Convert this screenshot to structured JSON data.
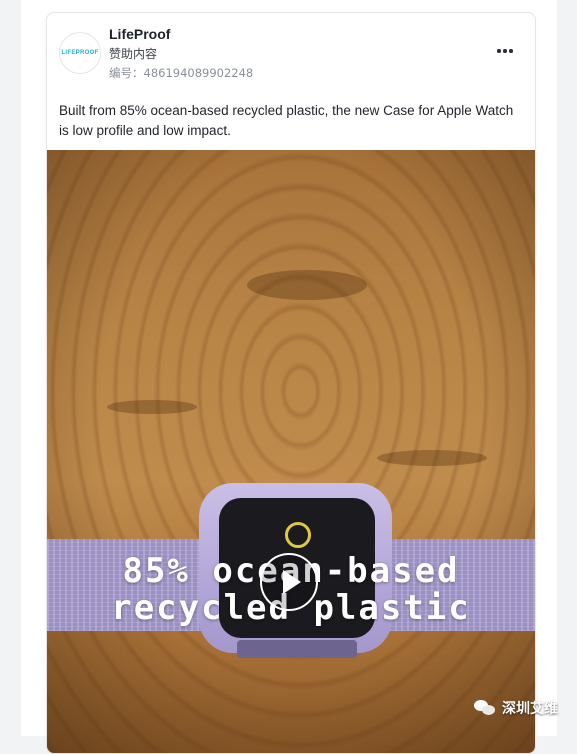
{
  "post": {
    "brand_name": "LifeProof",
    "avatar_text": "LIFEPROOF",
    "sponsored_label": "赞助内容",
    "id_label": "编号：",
    "id_value": "486194089902248",
    "description": "Built from 85% ocean-based recycled plastic, the new Case for Apple Watch is low profile and low impact.",
    "more_icon": "more-horizontal-icon"
  },
  "video": {
    "caption_line1": "85% ocean-based",
    "caption_line2": "recycled plastic",
    "play_icon": "play-icon"
  },
  "watermark": {
    "text": "深圳艾维",
    "icon": "wechat-icon"
  },
  "colors": {
    "page_bg": "#f2f3f5",
    "card_bg": "#ffffff",
    "avatar_brand": "#19b5c9",
    "text_primary": "#1f2329",
    "text_muted": "#8a8f99"
  }
}
